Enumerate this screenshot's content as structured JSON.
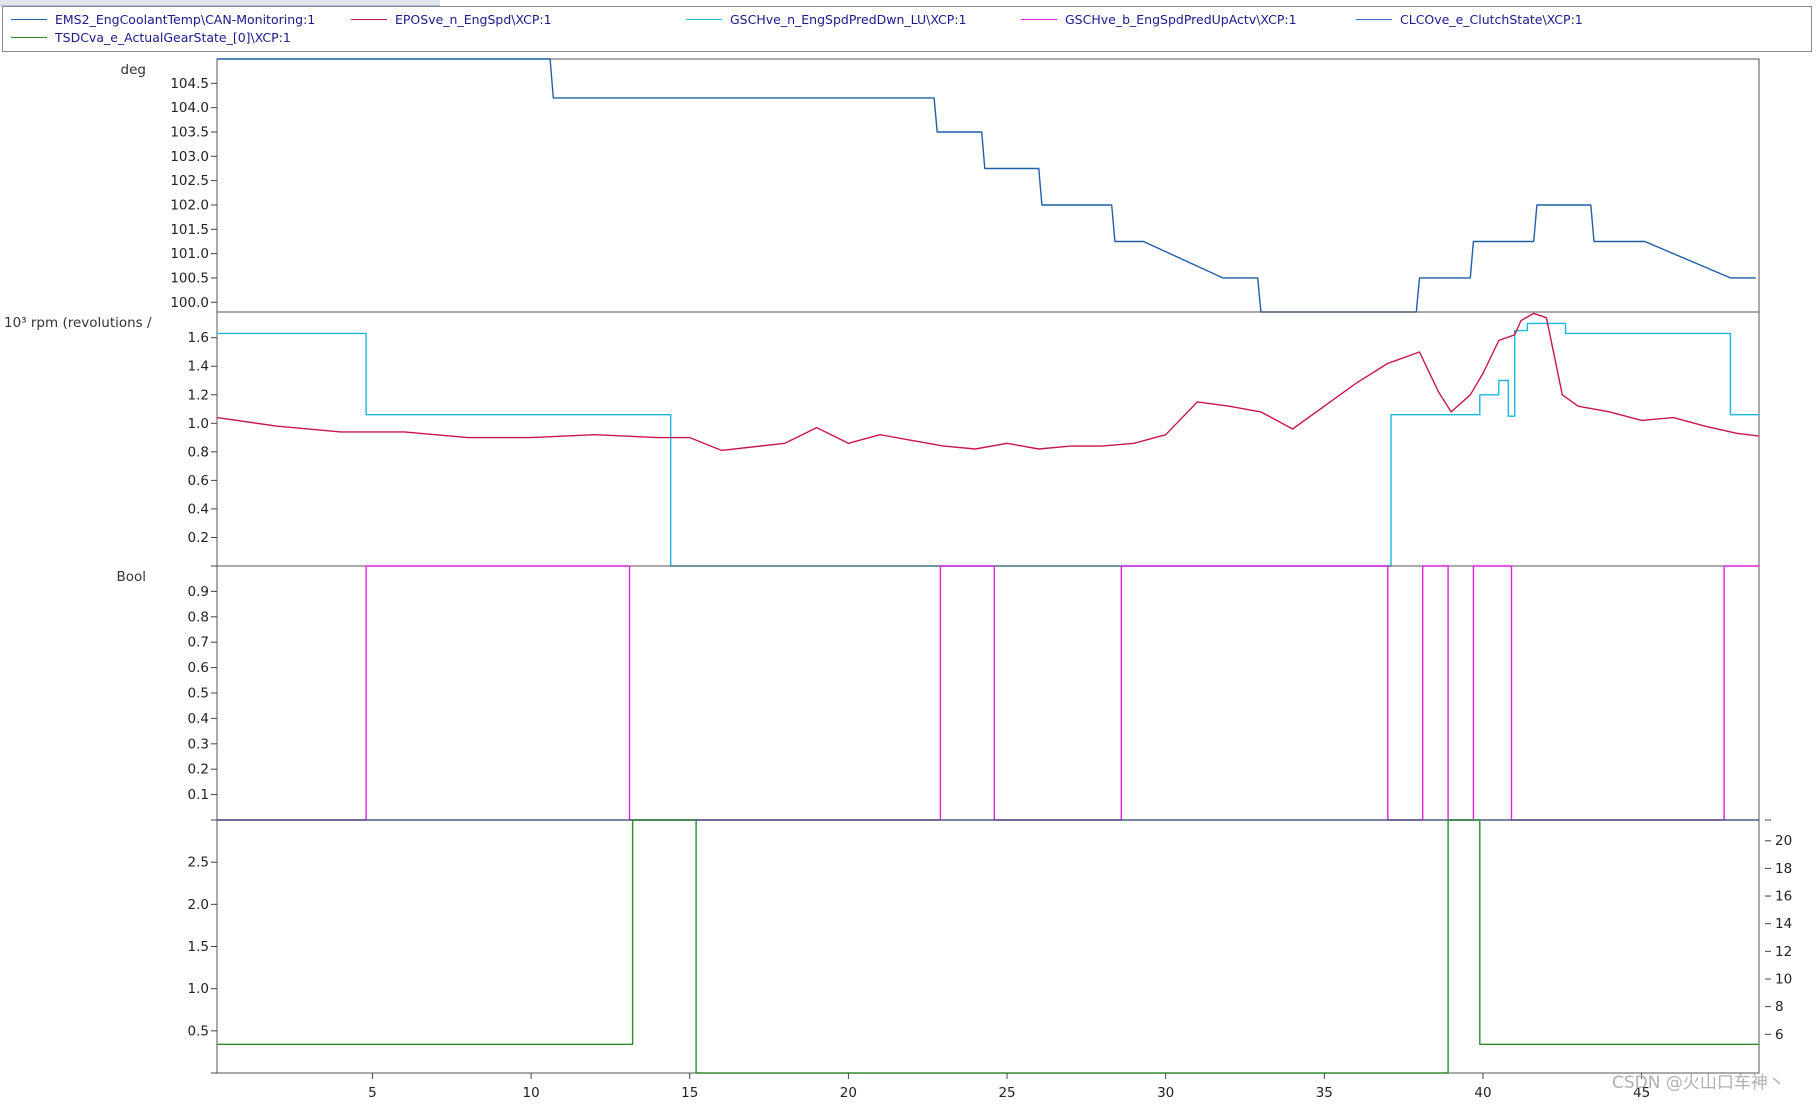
{
  "legend": [
    {
      "name": "EMS2_EngCoolantTemp\\CAN-Monitoring:1",
      "color": "#1f5fa8"
    },
    {
      "name": "EPOSve_n_EngSpd\\XCP:1",
      "color": "#c8174e"
    },
    {
      "name": "GSCHve_n_EngSpdPredDwn_LU\\XCP:1",
      "color": "#1ab8e0"
    },
    {
      "name": "GSCHve_b_EngSpdPredUpActv\\XCP:1",
      "color": "#e020e0"
    },
    {
      "name": "CLCOve_e_ClutchState\\XCP:1",
      "color": "#3a6fd0"
    },
    {
      "name": "TSDCva_e_ActualGearState_[0]\\XCP:1",
      "color": "#2e8b2e"
    }
  ],
  "watermark": "CSDN @火山口车神丶",
  "chart_data": {
    "type": "line",
    "x_ticks": [
      5,
      10,
      15,
      20,
      25,
      30,
      35,
      40,
      45
    ],
    "xlim": [
      0.1,
      48.7
    ],
    "panels": [
      {
        "unit": "deg",
        "ylim": [
          99.8,
          105.0
        ],
        "y_ticks": [
          "100.0",
          "100.5",
          "101.0",
          "101.5",
          "102.0",
          "102.5",
          "103.0",
          "103.5",
          "104.0",
          "104.5"
        ],
        "series": [
          {
            "name": "EMS2_EngCoolantTemp\\CAN-Monitoring:1",
            "color": "#1f5fa8",
            "step": false,
            "x": [
              0.1,
              10.6,
              10.7,
              22.7,
              22.8,
              24.2,
              24.3,
              26.0,
              26.1,
              28.3,
              28.4,
              29.3,
              31.8,
              32.9,
              33.0,
              37.9,
              38.0,
              39.6,
              39.7,
              41.6,
              41.7,
              43.4,
              43.5,
              45.1,
              47.8,
              48.6
            ],
            "y": [
              105.0,
              105.0,
              104.2,
              104.2,
              103.5,
              103.5,
              102.75,
              102.75,
              102.0,
              102.0,
              101.25,
              101.25,
              100.5,
              100.5,
              99.8,
              99.8,
              100.5,
              100.5,
              101.25,
              101.25,
              102.0,
              102.0,
              101.25,
              101.25,
              100.5,
              100.5
            ]
          }
        ]
      },
      {
        "unit": "10³ rpm (revolutions /",
        "ylim": [
          0.0,
          1.78
        ],
        "y_ticks": [
          "",
          "0.2",
          "0.4",
          "0.6",
          "0.8",
          "1.0",
          "1.2",
          "1.4",
          "1.6"
        ],
        "series": [
          {
            "name": "GSCHve_n_EngSpdPredDwn_LU\\XCP:1",
            "color": "#1ab8e0",
            "step": true,
            "x": [
              0.1,
              4.8,
              14.3,
              14.4,
              37.0,
              37.1,
              38.8,
              39.9,
              40.5,
              40.8,
              41.0,
              41.4,
              42.6,
              47.8,
              48.7
            ],
            "y": [
              1.63,
              1.06,
              1.06,
              0.0,
              0.0,
              1.06,
              1.06,
              1.2,
              1.3,
              1.05,
              1.65,
              1.7,
              1.63,
              1.06,
              1.06
            ]
          },
          {
            "name": "EPOSve_n_EngSpd\\XCP:1",
            "color": "#c8174e",
            "step": false,
            "x": [
              0.1,
              2,
              4,
              6,
              8,
              10,
              12,
              14,
              15,
              16,
              18,
              19,
              20,
              21,
              22,
              23,
              24,
              25,
              26,
              27,
              28,
              29,
              30,
              31,
              32,
              33,
              34,
              35,
              36,
              37,
              38,
              38.6,
              39,
              39.6,
              40,
              40.5,
              41,
              41.2,
              41.6,
              42,
              42.5,
              43,
              44,
              45,
              46,
              47,
              48,
              48.7
            ],
            "y": [
              1.04,
              0.98,
              0.94,
              0.94,
              0.9,
              0.9,
              0.92,
              0.9,
              0.9,
              0.81,
              0.86,
              0.97,
              0.86,
              0.92,
              0.88,
              0.84,
              0.82,
              0.86,
              0.82,
              0.84,
              0.84,
              0.86,
              0.92,
              1.15,
              1.12,
              1.08,
              0.96,
              1.12,
              1.28,
              1.42,
              1.5,
              1.22,
              1.08,
              1.2,
              1.35,
              1.58,
              1.62,
              1.72,
              1.77,
              1.74,
              1.2,
              1.12,
              1.08,
              1.02,
              1.04,
              0.98,
              0.93,
              0.91
            ]
          }
        ]
      },
      {
        "unit": "Bool",
        "ylim": [
          0.0,
          1.0
        ],
        "y_ticks": [
          "",
          "0.1",
          "0.2",
          "0.3",
          "0.4",
          "0.5",
          "0.6",
          "0.7",
          "0.8",
          "0.9"
        ],
        "series": [
          {
            "name": "GSCHve_b_EngSpdPredUpActv\\XCP:1",
            "color": "#e020e0",
            "step": true,
            "x": [
              0.1,
              4.8,
              13.1,
              22.9,
              24.6,
              28.6,
              37.0,
              38.1,
              38.9,
              39.7,
              40.9,
              47.6,
              48.7
            ],
            "y": [
              0,
              1,
              0,
              1,
              0,
              1,
              0,
              1,
              0,
              1,
              0,
              1,
              1
            ]
          },
          {
            "name": "CLCOve_e_ClutchState\\XCP:1",
            "color": "#3a6fd0",
            "step": true,
            "x": [
              0.1,
              48.7
            ],
            "y": [
              0,
              0
            ]
          }
        ]
      },
      {
        "unit": "",
        "ylim": [
          0.0,
          3.0
        ],
        "y_ticks": [
          "",
          "0.5",
          "1.0",
          "1.5",
          "2.0",
          "2.5"
        ],
        "right_ylim": [
          3.2,
          21.5
        ],
        "right_ticks": [
          "6",
          "8",
          "10",
          "12",
          "14",
          "16",
          "18",
          "20"
        ],
        "series": [
          {
            "name": "TSDCva_e_ActualGearState_[0]\\XCP:1",
            "color": "#2e8b2e",
            "step": true,
            "x": [
              0.1,
              13.2,
              15.2,
              38.9,
              39.9,
              48.7
            ],
            "y": [
              0.34,
              3.0,
              0.0,
              3.0,
              0.34,
              0.34
            ]
          }
        ]
      }
    ]
  }
}
